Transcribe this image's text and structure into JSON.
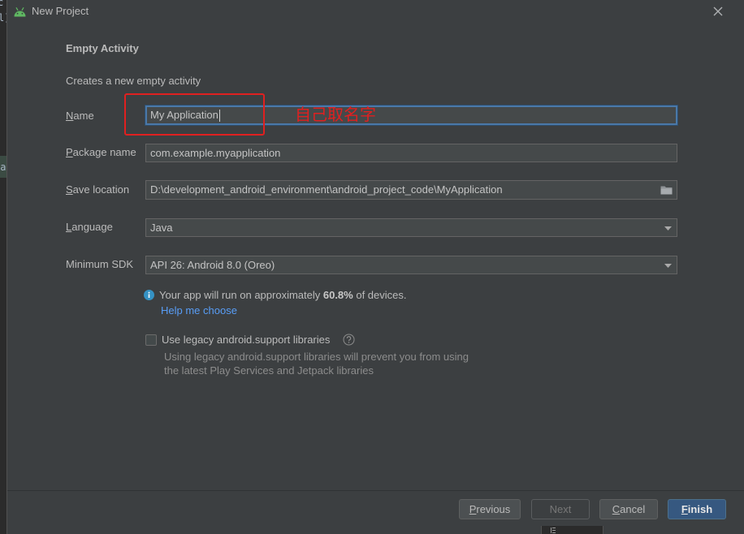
{
  "window": {
    "title": "New Project",
    "app_icon": "android-icon",
    "close_icon": "close-icon"
  },
  "ide_fragments": [
    "c",
    "l]",
    "ea"
  ],
  "template": {
    "name": "Empty Activity",
    "description": "Creates a new empty activity"
  },
  "form": {
    "name": {
      "label": "Name",
      "value": "My Application"
    },
    "package_name": {
      "label": "Package name",
      "value": "com.example.myapplication"
    },
    "save_location": {
      "label": "Save location",
      "value": "D:\\development_android_environment\\android_project_code\\MyApplication",
      "icon": "folder-icon"
    },
    "language": {
      "label": "Language",
      "selected": "Java",
      "icon": "chevron-down-icon"
    },
    "minimum_sdk": {
      "label": "Minimum SDK",
      "selected": "API 26: Android 8.0 (Oreo)",
      "icon": "chevron-down-icon"
    }
  },
  "sdk_info": {
    "icon": "info-icon",
    "text_before": "Your app will run on approximately ",
    "percentage": "60.8%",
    "text_after": " of devices.",
    "help_link": "Help me choose"
  },
  "legacy_support": {
    "label": "Use legacy android.support libraries",
    "checked": false,
    "help_icon": "help-icon",
    "hint_line1": "Using legacy android.support libraries will prevent you from using",
    "hint_line2": "the latest Play Services and Jetpack libraries"
  },
  "annotation": {
    "text": "自己取名字"
  },
  "buttons": {
    "previous": "Previous",
    "next": "Next",
    "next_enabled": false,
    "cancel": "Cancel",
    "finish": "Finish"
  },
  "colors": {
    "link": "#589df6",
    "accent": "#365880",
    "annotation": "#e02020",
    "info_icon": "#3592c4",
    "android_logo": "#5fb862"
  }
}
